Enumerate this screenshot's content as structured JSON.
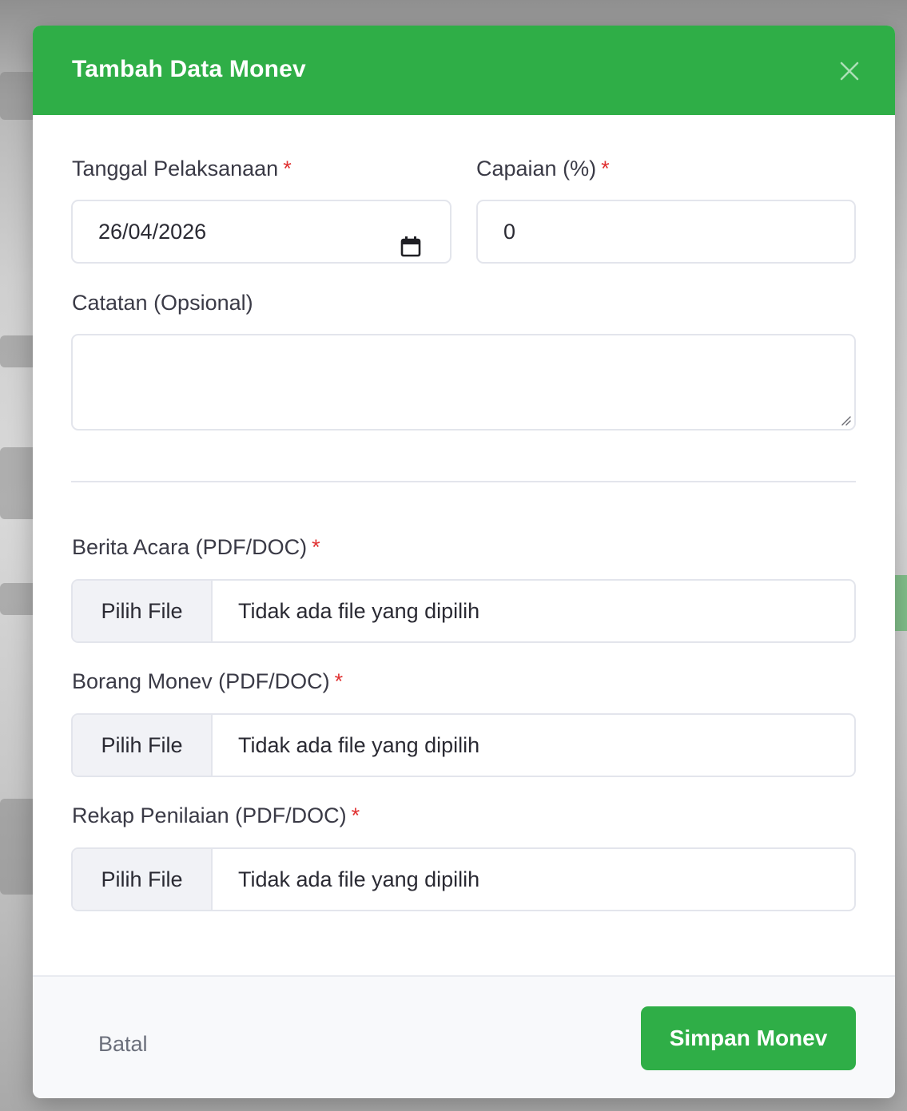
{
  "modal": {
    "title": "Tambah Data Monev",
    "close_icon": "close-icon"
  },
  "form": {
    "tanggal": {
      "label": "Tanggal Pelaksanaan",
      "required_mark": "*",
      "value": "26/04/2026",
      "icon": "calendar-icon"
    },
    "capaian": {
      "label": "Capaian (%)",
      "required_mark": "*",
      "value": "0"
    },
    "catatan": {
      "label": "Catatan (Opsional)",
      "value": ""
    },
    "files": [
      {
        "label": "Berita Acara (PDF/DOC)",
        "required_mark": "*",
        "button_label": "Pilih File",
        "status": "Tidak ada file yang dipilih"
      },
      {
        "label": "Borang Monev (PDF/DOC)",
        "required_mark": "*",
        "button_label": "Pilih File",
        "status": "Tidak ada file yang dipilih"
      },
      {
        "label": "Rekap Penilaian (PDF/DOC)",
        "required_mark": "*",
        "button_label": "Pilih File",
        "status": "Tidak ada file yang dipilih"
      }
    ]
  },
  "footer": {
    "cancel_label": "Batal",
    "save_label": "Simpan Monev"
  },
  "colors": {
    "primary": "#2fae47",
    "required": "#e03131",
    "border": "#e3e5ec"
  }
}
